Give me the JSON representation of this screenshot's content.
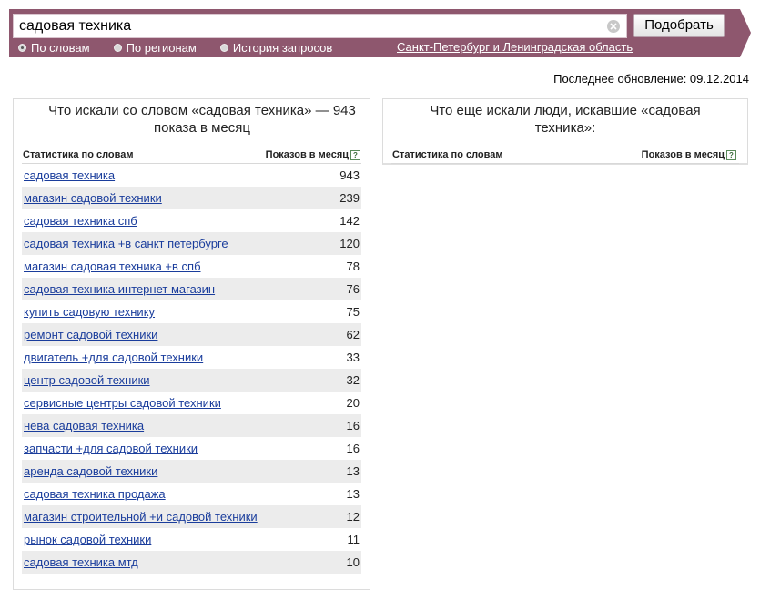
{
  "search": {
    "value": "садовая техника",
    "submit_label": "Подобрать"
  },
  "modes": [
    {
      "label": "По словам",
      "checked": true
    },
    {
      "label": "По регионам",
      "checked": false
    },
    {
      "label": "История запросов",
      "checked": false
    }
  ],
  "region_label": "Санкт-Петербург и Ленинградская область",
  "last_update": "Последнее обновление: 09.12.2014",
  "left_panel": {
    "title": "Что искали со словом «садовая техника» — 943 показа в месяц",
    "col_words": "Статистика по словам",
    "col_shows": "Показов в месяц",
    "rows": [
      {
        "kw": "садовая техника",
        "count": "943"
      },
      {
        "kw": "магазин садовой техники",
        "count": "239"
      },
      {
        "kw": "садовая техника спб",
        "count": "142"
      },
      {
        "kw": "садовая техника +в санкт петербурге",
        "count": "120"
      },
      {
        "kw": "магазин садовая техника +в спб",
        "count": "78"
      },
      {
        "kw": "садовая техника интернет магазин",
        "count": "76"
      },
      {
        "kw": "купить садовую технику",
        "count": "75"
      },
      {
        "kw": "ремонт садовой техники",
        "count": "62"
      },
      {
        "kw": "двигатель +для садовой техники",
        "count": "33"
      },
      {
        "kw": "центр садовой техники",
        "count": "32"
      },
      {
        "kw": "сервисные центры садовой техники",
        "count": "20"
      },
      {
        "kw": "нева садовая техника",
        "count": "16"
      },
      {
        "kw": "запчасти +для садовой техники",
        "count": "16"
      },
      {
        "kw": "аренда садовой техники",
        "count": "13"
      },
      {
        "kw": "садовая техника продажа",
        "count": "13"
      },
      {
        "kw": "магазин строительной +и садовой техники",
        "count": "12"
      },
      {
        "kw": "рынок садовой техники",
        "count": "11"
      },
      {
        "kw": "садовая техника мтд",
        "count": "10"
      }
    ]
  },
  "right_panel": {
    "title": "Что еще искали люди, искавшие «садовая техника»:",
    "col_words": "Статистика по словам",
    "col_shows": "Показов в месяц"
  },
  "icons": {
    "clear": "clear-icon",
    "help": "help-icon",
    "help_glyph": "?"
  },
  "colors": {
    "topbar": "#8e576e",
    "link": "#1a3d9c",
    "row_alt": "#ececec"
  }
}
